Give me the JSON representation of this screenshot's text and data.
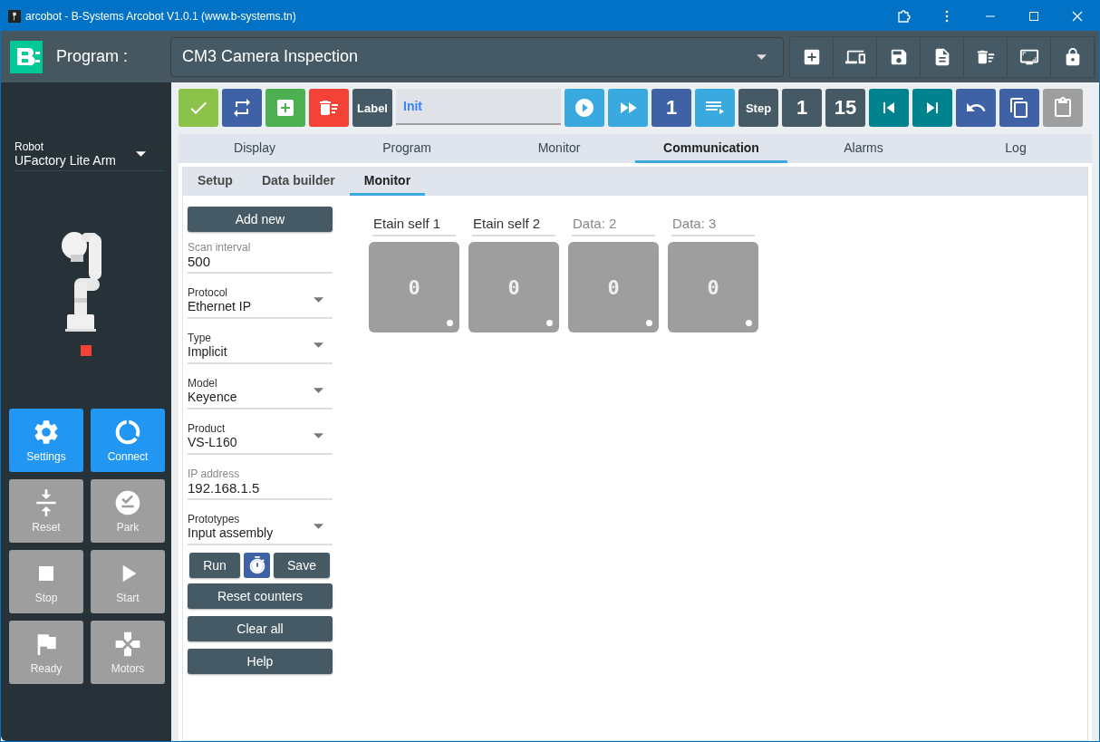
{
  "window": {
    "title": "arcobot - B-Systems Arcobot V1.0.1 (www.b-systems.tn)"
  },
  "header": {
    "label": "Program :",
    "program": "CM3 Camera Inspection",
    "tools": [
      {
        "kind": "add"
      },
      {
        "kind": "devices"
      },
      {
        "kind": "save"
      },
      {
        "kind": "document"
      },
      {
        "kind": "delete"
      },
      {
        "kind": "screen"
      },
      {
        "kind": "lock"
      }
    ]
  },
  "robot": {
    "label": "Robot",
    "value": "UFactory Lite Arm"
  },
  "side_buttons": [
    {
      "label": "Settings",
      "kind": "settings",
      "disabled": false
    },
    {
      "label": "Connect",
      "kind": "connect",
      "disabled": false
    },
    {
      "label": "Reset",
      "kind": "reset",
      "disabled": true
    },
    {
      "label": "Park",
      "kind": "park",
      "disabled": true
    },
    {
      "label": "Stop",
      "kind": "stop",
      "disabled": true
    },
    {
      "label": "Start",
      "kind": "start",
      "disabled": true
    },
    {
      "label": "Ready",
      "kind": "ready",
      "disabled": true
    },
    {
      "label": "Motors",
      "kind": "motors",
      "disabled": true
    }
  ],
  "toolbar": [
    {
      "kind": "check",
      "color": "#8bc34a"
    },
    {
      "kind": "repeat",
      "color": "#3f62a6"
    },
    {
      "kind": "add",
      "color": "#4caf50"
    },
    {
      "kind": "delete",
      "color": "#f44336"
    },
    {
      "kind": "text",
      "label": "Label",
      "color": "#455a64"
    },
    {
      "kind": "field",
      "value": "Init"
    },
    {
      "kind": "play",
      "color": "#3aa9df"
    },
    {
      "kind": "fastforward",
      "color": "#3aa9df"
    },
    {
      "kind": "text",
      "label": "1",
      "color": "#3f62a6"
    },
    {
      "kind": "playlist",
      "color": "#3aa9df"
    },
    {
      "kind": "text",
      "label": "Step",
      "color": "#455a64"
    },
    {
      "kind": "text",
      "label": "1",
      "color": "#455a64"
    },
    {
      "kind": "text",
      "label": "15",
      "color": "#455a64"
    },
    {
      "kind": "previous",
      "color": "#00838f"
    },
    {
      "kind": "next",
      "color": "#00838f"
    },
    {
      "kind": "undo",
      "color": "#3f62a6"
    },
    {
      "kind": "copy",
      "color": "#3f62a6"
    },
    {
      "kind": "paste",
      "color": "#9e9e9e"
    }
  ],
  "tabs": [
    {
      "label": "Display",
      "selected": false
    },
    {
      "label": "Program",
      "selected": false
    },
    {
      "label": "Monitor",
      "selected": false
    },
    {
      "label": "Communication",
      "selected": true
    },
    {
      "label": "Alarms",
      "selected": false
    },
    {
      "label": "Log",
      "selected": false
    }
  ],
  "subtabs": [
    {
      "label": "Setup",
      "selected": false
    },
    {
      "label": "Data builder",
      "selected": false
    },
    {
      "label": "Monitor",
      "selected": true
    }
  ],
  "add_button": "Add new",
  "fields": [
    {
      "kind": "text",
      "label": "Scan interval",
      "value": "500"
    },
    {
      "kind": "select",
      "label": "Protocol",
      "value": "Ethernet IP"
    },
    {
      "kind": "select",
      "label": "Type",
      "value": "Implicit"
    },
    {
      "kind": "select",
      "label": "Model",
      "value": "Keyence"
    },
    {
      "kind": "select",
      "label": "Product",
      "value": "VS-L160"
    },
    {
      "kind": "text",
      "label": "IP address",
      "value": "192.168.1.5"
    },
    {
      "kind": "select",
      "label": "Prototypes",
      "value": "Input assembly"
    }
  ],
  "run_button": "Run",
  "save_button": "Save",
  "actions": [
    "Reset counters",
    "Clear all",
    "Help"
  ],
  "tiles": [
    {
      "name": "Etain self 1",
      "display": "0"
    },
    {
      "name": "Etain self 2",
      "display": "0"
    },
    {
      "placeholder": "Data: 2",
      "display": "0"
    },
    {
      "placeholder": "Data: 3",
      "display": "0"
    }
  ]
}
